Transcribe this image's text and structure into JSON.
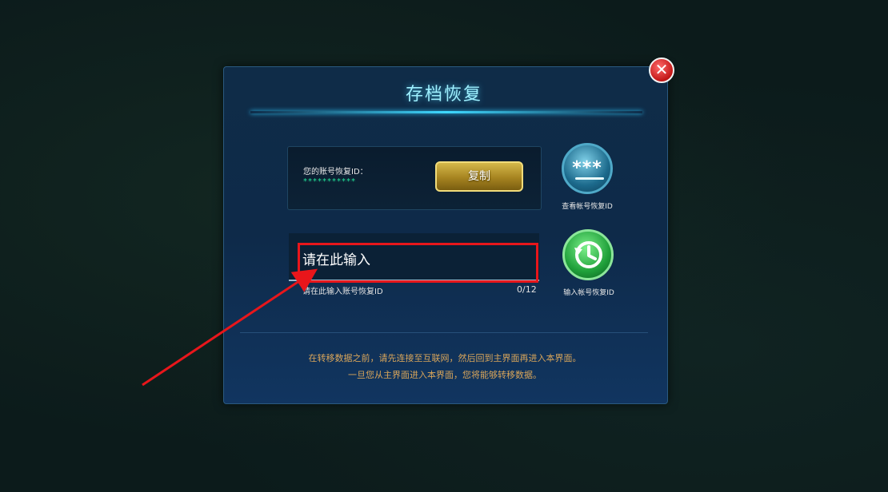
{
  "dialog": {
    "title": "存档恢复",
    "close_symbol": "✕"
  },
  "account": {
    "id_label": "您的账号恢复ID：",
    "id_masked": "***********",
    "copy_label": "复制"
  },
  "view_id": {
    "icon": "masked-password-icon",
    "stars": "***",
    "label": "查看帐号恢复ID"
  },
  "input": {
    "placeholder": "请在此输入",
    "hint": "请在此输入账号恢复ID",
    "count": "0/12"
  },
  "restore": {
    "icon": "history-restore-icon",
    "label": "输入帐号恢复ID"
  },
  "footer": {
    "line1": "在转移数据之前，请先连接至互联网，然后回到主界面再进入本界面。",
    "line2": "一旦您从主界面进入本界面，您将能够转移数据。"
  },
  "colors": {
    "title": "#9ef0ff",
    "annotation_red": "#e8161b",
    "footer_text": "#d8a55a",
    "id_mask": "#22e29a"
  }
}
